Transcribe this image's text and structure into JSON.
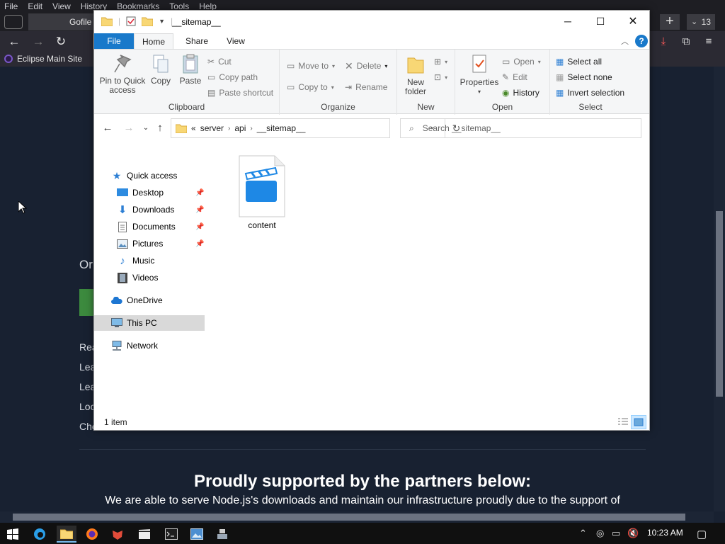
{
  "browser": {
    "menu": [
      "File",
      "Edit",
      "View",
      "History",
      "Bookmarks",
      "Tools",
      "Help"
    ],
    "tab_title": "Gofile",
    "tab_count": "13",
    "bookmark": "Eclipse Main Site",
    "page_fragments": [
      "Or",
      "Rea",
      "Lea",
      "Lea",
      "Loc",
      "Che"
    ],
    "partners_title": "Proudly supported by the partners below:",
    "partners_subtitle": "We are able to serve Node.js's downloads and maintain our infrastructure proudly due to the support of"
  },
  "explorer": {
    "title": "__sitemap__",
    "ribbon_tabs": [
      "File",
      "Home",
      "Share",
      "View"
    ],
    "clipboard": {
      "pin": "Pin to Quick access",
      "copy": "Copy",
      "paste": "Paste",
      "cut": "Cut",
      "copy_path": "Copy path",
      "paste_shortcut": "Paste shortcut",
      "label": "Clipboard"
    },
    "organize": {
      "move_to": "Move to",
      "copy_to": "Copy to",
      "delete": "Delete",
      "rename": "Rename",
      "label": "Organize"
    },
    "new": {
      "new_folder": "New folder",
      "label": "New"
    },
    "open": {
      "properties": "Properties",
      "open": "Open",
      "edit": "Edit",
      "history": "History",
      "label": "Open"
    },
    "select": {
      "select_all": "Select all",
      "select_none": "Select none",
      "invert": "Invert selection",
      "label": "Select"
    },
    "address": {
      "prefix": "«",
      "crumbs": [
        "server",
        "api",
        "__sitemap__"
      ]
    },
    "search_placeholder": "Search __sitemap__",
    "nav": {
      "quick_access": "Quick access",
      "desktop": "Desktop",
      "downloads": "Downloads",
      "documents": "Documents",
      "pictures": "Pictures",
      "music": "Music",
      "videos": "Videos",
      "onedrive": "OneDrive",
      "this_pc": "This PC",
      "network": "Network"
    },
    "files": [
      {
        "name": "content"
      }
    ],
    "status": "1 item"
  },
  "taskbar": {
    "clock": "10:23 AM"
  },
  "colors": {
    "accent": "#1979ca",
    "page_bg": "#182131",
    "taskbar": "#101010"
  }
}
